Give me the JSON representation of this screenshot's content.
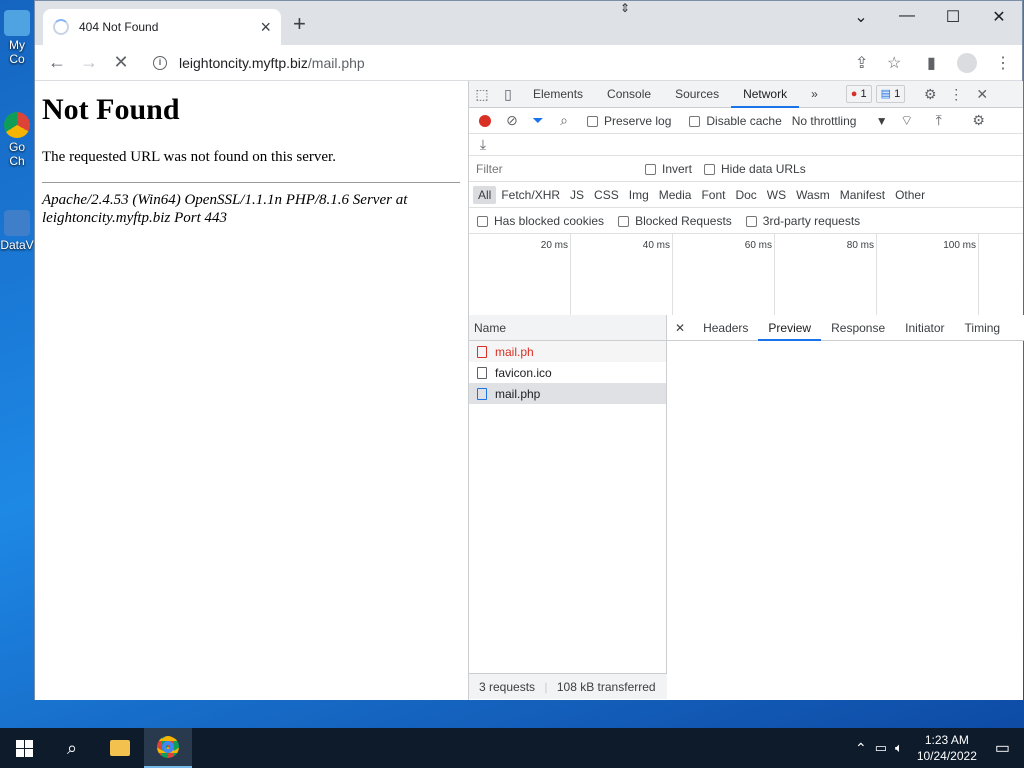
{
  "desktop": {
    "icons": [
      {
        "label": "My Co",
        "icon": "this-pc-icon"
      },
      {
        "label": "Go Ch",
        "icon": "chrome-shortcut-icon"
      },
      {
        "label": "DataV",
        "icon": "datav-shortcut-icon"
      }
    ]
  },
  "browser": {
    "tab_title": "404 Not Found",
    "url_host": "leightoncity.myftp.biz",
    "url_path": "/mail.php",
    "window_controls": [
      "minimize-icon",
      "maximize-icon",
      "close-icon"
    ]
  },
  "page": {
    "heading": "Not Found",
    "message": "The requested URL was not found on this server.",
    "server_signature": "Apache/2.4.53 (Win64) OpenSSL/1.1.1n PHP/8.1.6 Server at leightoncity.myftp.biz Port 443"
  },
  "devtools": {
    "tabs": [
      "Elements",
      "Console",
      "Sources",
      "Network"
    ],
    "active_tab": "Network",
    "more_tabs": "»",
    "error_count": "1",
    "message_count": "1",
    "preserve_log": "Preserve log",
    "disable_cache": "Disable cache",
    "throttling": "No throttling",
    "filter_placeholder": "Filter",
    "invert": "Invert",
    "hide_data_urls": "Hide data URLs",
    "types": [
      "All",
      "Fetch/XHR",
      "JS",
      "CSS",
      "Img",
      "Media",
      "Font",
      "Doc",
      "WS",
      "Wasm",
      "Manifest",
      "Other"
    ],
    "has_blocked_cookies": "Has blocked cookies",
    "blocked_requests": "Blocked Requests",
    "third_party": "3rd-party requests",
    "timeline_ticks": [
      "20 ms",
      "40 ms",
      "60 ms",
      "80 ms",
      "100 ms"
    ],
    "name_header": "Name",
    "requests": [
      {
        "name": "mail.ph",
        "color": "#d93025",
        "icon": "red"
      },
      {
        "name": "favicon.ico",
        "color": "#202124",
        "icon": "plain"
      },
      {
        "name": "mail.php",
        "color": "#202124",
        "icon": "blue"
      }
    ],
    "detail_tabs": [
      "Headers",
      "Preview",
      "Response",
      "Initiator",
      "Timing"
    ],
    "active_detail_tab": "Preview",
    "footer_requests": "3 requests",
    "footer_transferred": "108 kB transferred"
  },
  "taskbar": {
    "time": "1:23 AM",
    "date": "10/24/2022"
  }
}
